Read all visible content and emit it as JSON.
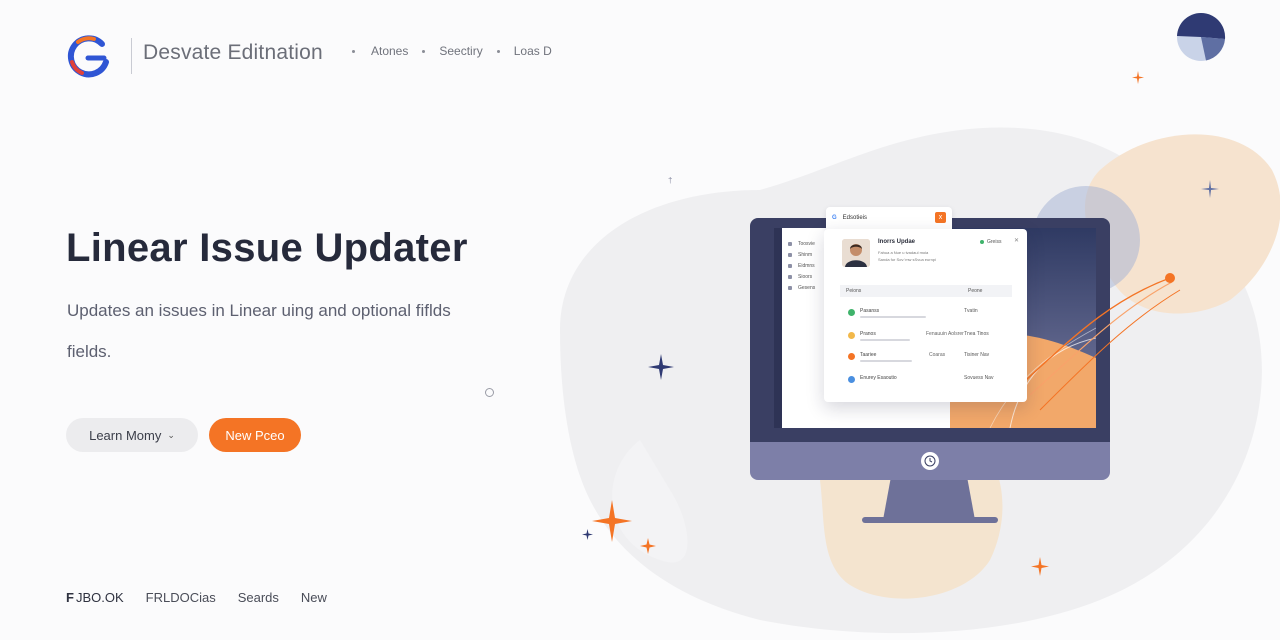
{
  "header": {
    "brand_name": "Desvate Editnation",
    "nav": [
      {
        "label": "Atones"
      },
      {
        "label": "Seectiry"
      },
      {
        "label": "Loas D"
      }
    ]
  },
  "hero": {
    "title": "Linear Issue Updater",
    "subtitle_line1": "Updates an issues in Linear uing and optional fiflds",
    "subtitle_line2": "fields.",
    "secondary_button": "Learn Momy",
    "primary_button": "New Pceo"
  },
  "footer": {
    "items": [
      {
        "label": "JBO.OK",
        "mark": "F"
      },
      {
        "label": "FRLDOCias"
      },
      {
        "label": "Seards"
      },
      {
        "label": "New"
      }
    ]
  },
  "monitor": {
    "sidebar_items": [
      "Toosvie",
      "Shinm",
      "Eidmns",
      "Sioors",
      "Gesens"
    ],
    "tab_label": "Edsotieis",
    "tab_g": "G",
    "tab_close": "x",
    "card": {
      "name": "Inorrs Updae",
      "line1": "Fahua a Nue u tvadaul moia",
      "line2": "Sanda fur Sov:'mw sSvua eurnpi",
      "status": "Greiss",
      "close": "✕",
      "table_head_left": "Peions",
      "table_head_right": "Peone",
      "rows": [
        {
          "title": "Pasanss",
          "mid": "",
          "val": "Tvatin"
        },
        {
          "title": "Pranos",
          "mid": "Fenauuin Aolsrer",
          "val": "Tnea Tinos"
        },
        {
          "title": "Taariee",
          "mid": "Coaras",
          "val": "Tisiner Nav"
        },
        {
          "title": "Enurey Esaoutio",
          "mid": "",
          "val": "Sovuess Nav"
        }
      ]
    }
  },
  "colors": {
    "accent": "#f47425",
    "navy": "#3a3f63",
    "stand": "#6e7199",
    "title": "#262a3b"
  }
}
